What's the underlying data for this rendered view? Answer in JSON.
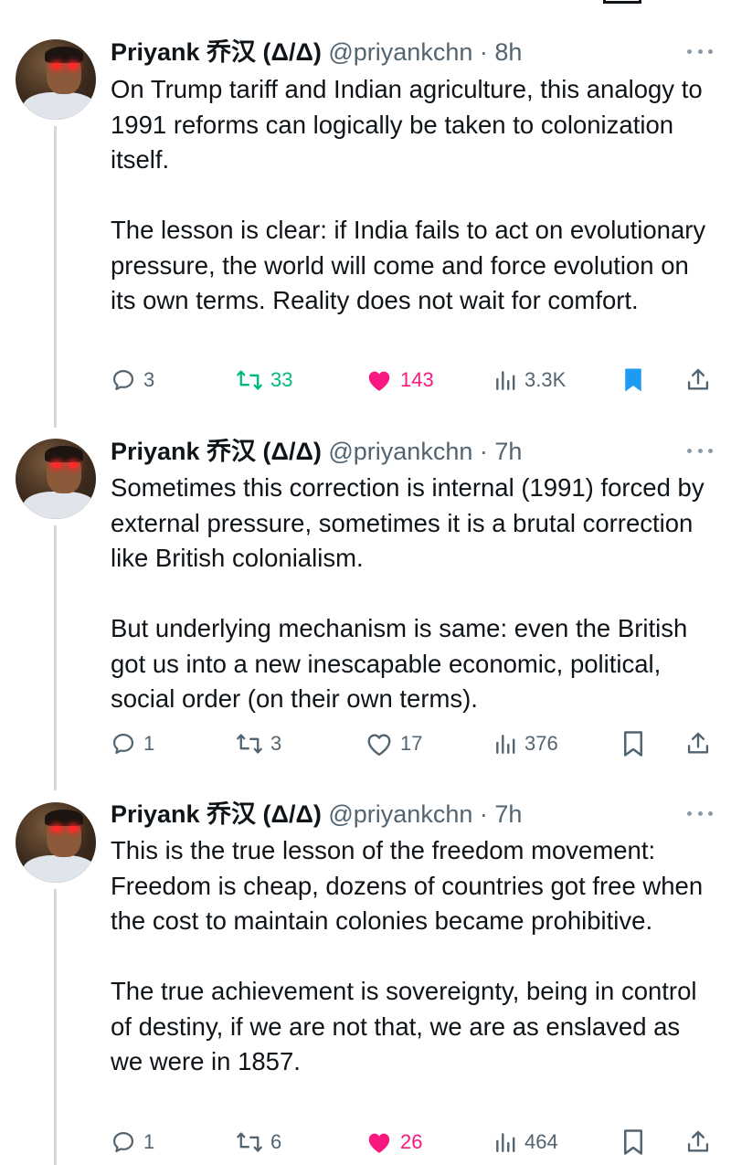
{
  "tweets": [
    {
      "author_name": "Priyank 乔汉 (Δ/Δ)",
      "handle_time": "@priyankchn · 8h",
      "paragraphs": [
        "On Trump tariff and Indian agriculture, this analogy to 1991 reforms can logically be taken to colonization itself.",
        "The lesson is clear: if India fails to act on evolutionary pressure, the world will come and force evolution on its own terms. Reality does not wait for comfort."
      ],
      "replies": "3",
      "retweets": "33",
      "likes": "143",
      "views": "3.3K",
      "retweeted": true,
      "liked": true,
      "bookmarked": true
    },
    {
      "author_name": "Priyank 乔汉 (Δ/Δ)",
      "handle_time": "@priyankchn · 7h",
      "paragraphs": [
        "Sometimes this correction is internal (1991) forced by external pressure, sometimes it is a brutal correction like British colonialism.",
        "But underlying mechanism is same: even the British got us into a new inescapable economic, political, social order (on their own terms)."
      ],
      "replies": "1",
      "retweets": "3",
      "likes": "17",
      "views": "376",
      "retweeted": false,
      "liked": false,
      "bookmarked": false
    },
    {
      "author_name": "Priyank 乔汉 (Δ/Δ)",
      "handle_time": "@priyankchn · 7h",
      "paragraphs": [
        "This is the true lesson of the freedom movement: Freedom is cheap, dozens of countries got free when the cost to maintain colonies became prohibitive.",
        "The true achievement is sovereignty, being in control of destiny, if we are not that, we are as enslaved as we were in 1857."
      ],
      "replies": "1",
      "retweets": "6",
      "likes": "26",
      "views": "464",
      "retweeted": false,
      "liked": true,
      "bookmarked": false
    }
  ],
  "icons": {
    "reply": "reply-icon",
    "retweet": "retweet-icon",
    "like": "heart-icon",
    "views": "views-icon",
    "bookmark": "bookmark-icon",
    "share": "share-icon",
    "more": "more-icon"
  },
  "colors": {
    "text": "#0f1419",
    "muted": "#536471",
    "retweet_active": "#00ba7c",
    "like_active": "#f91880",
    "bookmark_active": "#1d9bf0",
    "thread_line": "#cfd9de"
  }
}
